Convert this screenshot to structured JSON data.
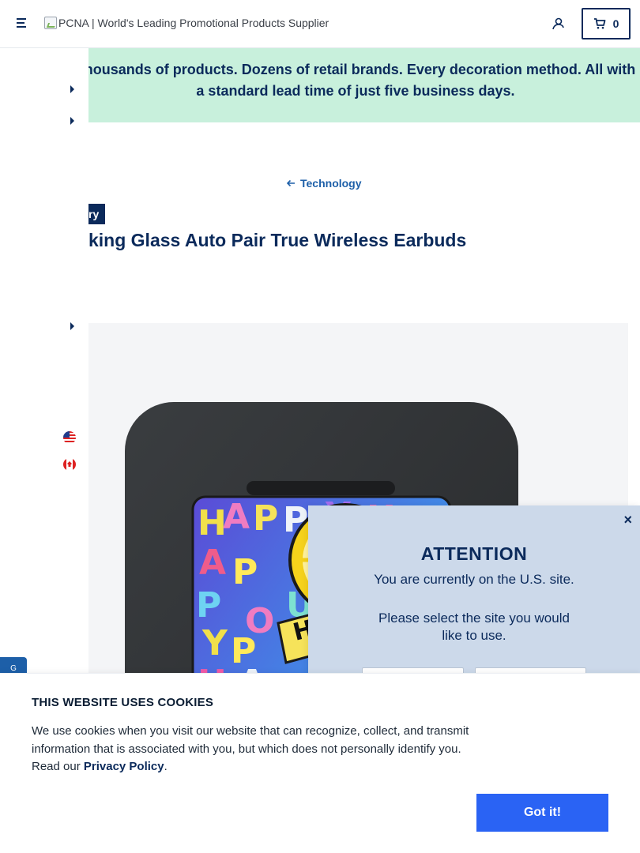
{
  "header": {
    "logo_alt": "PCNA | World's Leading Promotional Products Supplier",
    "cart_count": "0"
  },
  "banner": {
    "text": "Thousands of products. Dozens of retail brands. Every decoration method. All with a standard lead time of just five business days."
  },
  "breadcrumb": {
    "back_label": "Technology"
  },
  "product": {
    "category_badge": "ry",
    "title": "king Glass Auto Pair True Wireless Earbuds"
  },
  "popup": {
    "close_label": "×",
    "title": "ATTENTION",
    "message": "You are currently on the U.S. site.",
    "ask": "Please select the site you would like to use."
  },
  "chat": {
    "label": "G"
  },
  "cookie": {
    "title": "THIS WEBSITE USES COOKIES",
    "text_before": "We use cookies when you visit our website that can recognize, collect, and transmit information that is associated with you, but which does not personally identify you. Read our ",
    "link": "Privacy Policy",
    "text_after": ".",
    "button": "Got it!"
  },
  "colors": {
    "navy": "#0b2a5b",
    "banner_bg": "#c8f0dc",
    "popup_bg": "#ccd9ea",
    "cta_blue": "#2a63f4"
  },
  "icons": {
    "menu": "hamburger-icon",
    "account": "user-icon",
    "cart": "cart-icon",
    "back": "arrow-left-icon"
  }
}
